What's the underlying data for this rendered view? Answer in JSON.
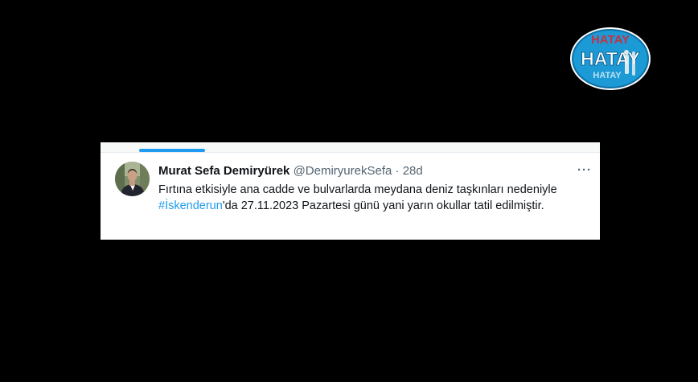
{
  "logo": {
    "text": "HATAY",
    "colors": {
      "primary": "#1b9ad6",
      "text": "#ffffff",
      "accent": "#e4202a"
    }
  },
  "tweet": {
    "author_name": "Murat Sefa Demiryürek",
    "handle": "@DemiryurekSefa",
    "separator": "·",
    "time": "28d",
    "more_label": "···",
    "text_before": "Fırtına etkisiyle ana cadde ve bulvarlarda meydana deniz taşkınları nedeniyle ",
    "hashtag": "#İskenderun",
    "text_after": "'da 27.11.2023 Pazartesi günü yani yarın okullar tatil edilmiştir."
  },
  "colors": {
    "background": "#000000",
    "card": "#ffffff",
    "link": "#1d9bf0",
    "muted": "#536471",
    "text": "#0f1419"
  },
  "icons": {
    "avatar": "user-avatar-photo",
    "more": "more-options-icon",
    "logo": "hatay-logo"
  }
}
